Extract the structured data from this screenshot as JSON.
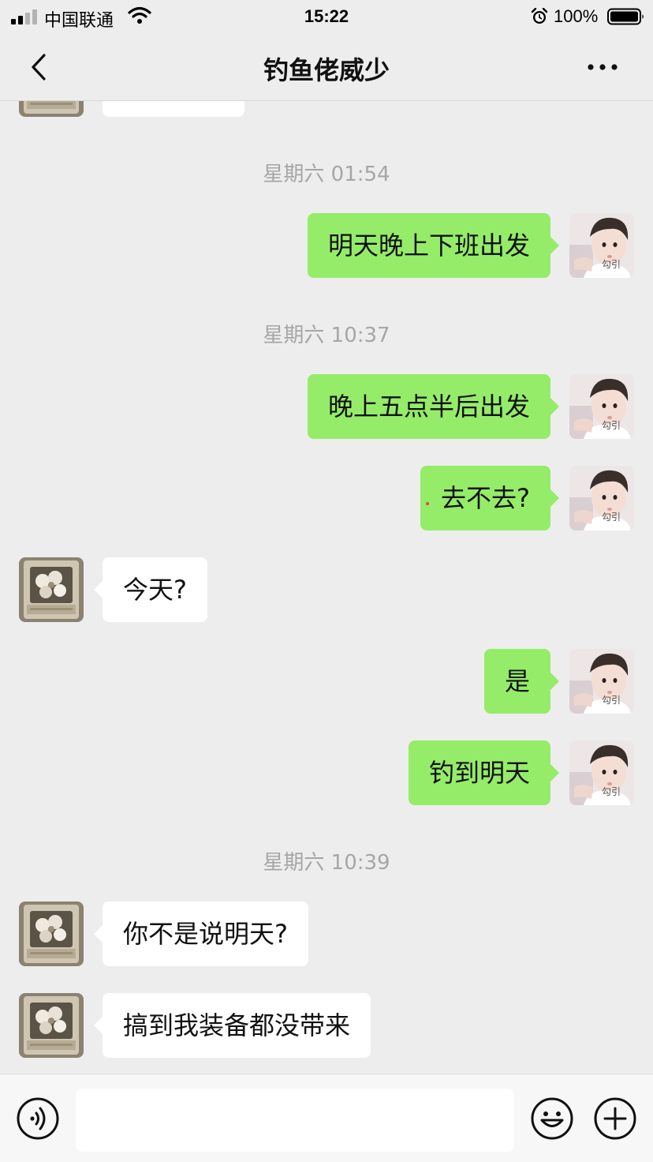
{
  "status_bar": {
    "carrier": "中国联通",
    "time": "15:22",
    "battery": "100%",
    "icons": [
      "signal-icon",
      "wifi-icon",
      "alarm-icon",
      "battery-icon"
    ]
  },
  "header": {
    "title": "钓鱼佬威少",
    "back_icon": "chevron-left-icon",
    "more_icon": "more-dots-icon"
  },
  "messages": [
    {
      "type": "timestamp",
      "text": "星期六 01:54"
    },
    {
      "type": "message",
      "from": "self",
      "text": "明天晚上下班出发"
    },
    {
      "type": "timestamp",
      "text": "星期六 10:37"
    },
    {
      "type": "message",
      "from": "self",
      "text": "晚上五点半后出发"
    },
    {
      "type": "message",
      "from": "self",
      "text": "去不去?"
    },
    {
      "type": "message",
      "from": "other",
      "text": "今天?"
    },
    {
      "type": "message",
      "from": "self",
      "text": "是"
    },
    {
      "type": "message",
      "from": "self",
      "text": "钓到明天"
    },
    {
      "type": "timestamp",
      "text": "星期六 10:39"
    },
    {
      "type": "message",
      "from": "other",
      "text": "你不是说明天?"
    },
    {
      "type": "message",
      "from": "other",
      "text": "搞到我装备都没带来"
    }
  ],
  "avatars": {
    "self_caption": "勾引"
  },
  "input_bar": {
    "value": "",
    "icons": [
      "voice-icon",
      "emoji-icon",
      "plus-icon"
    ]
  },
  "colors": {
    "background": "#ededed",
    "self_bubble": "#95ec69",
    "other_bubble": "#ffffff",
    "timestamp": "#a6a6a6"
  }
}
